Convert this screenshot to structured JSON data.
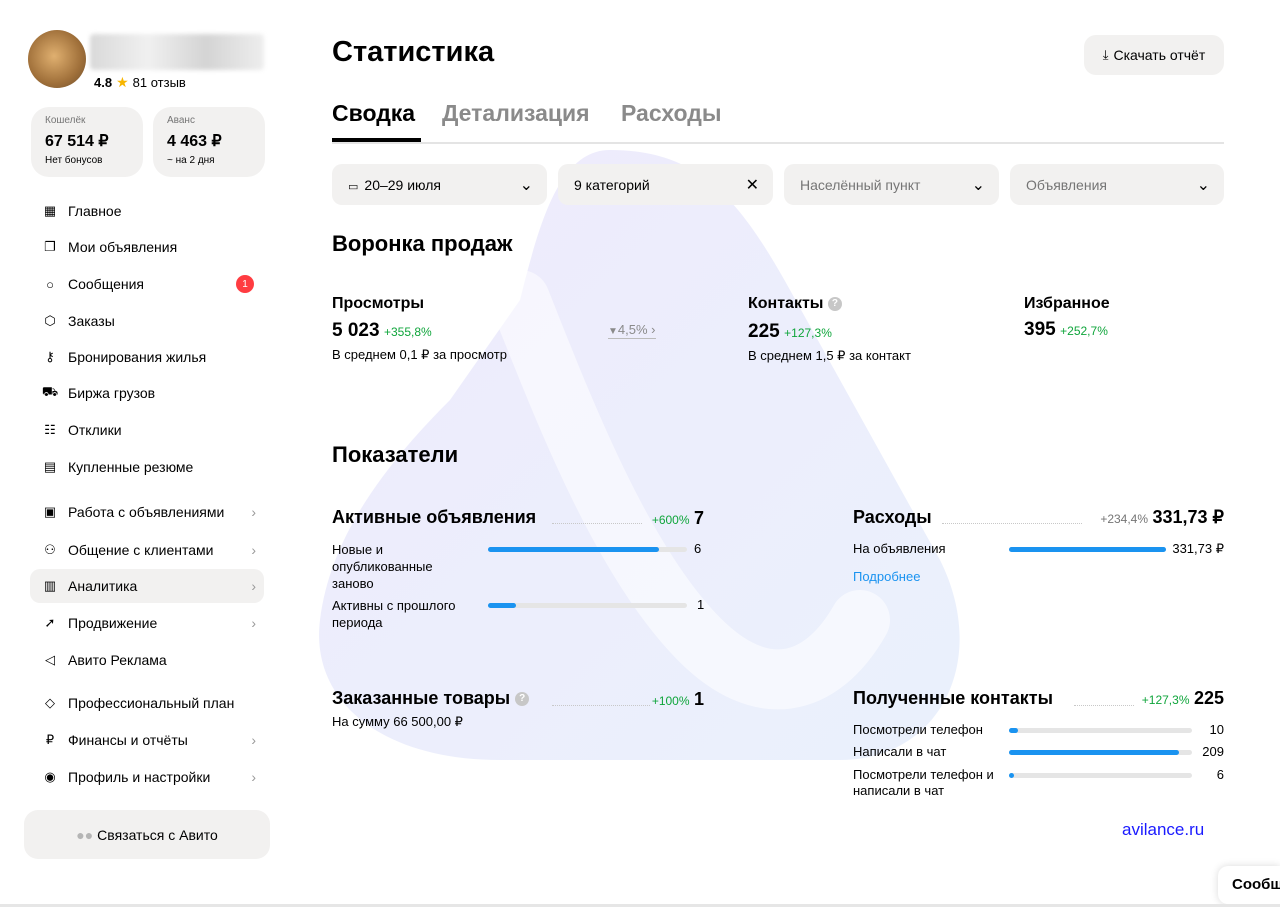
{
  "profile": {
    "rating": "4.8",
    "reviews": "81 отзыв"
  },
  "wallet": {
    "label": "Кошелёк",
    "value": "67 514 ₽",
    "sub": "Нет бонусов"
  },
  "advance": {
    "label": "Аванс",
    "value": "4 463 ₽",
    "sub": "~ на 2 дня"
  },
  "nav": [
    {
      "label": "Главное",
      "icon": "grid-icon"
    },
    {
      "label": "Мои объявления",
      "icon": "copy-icon"
    },
    {
      "label": "Сообщения",
      "icon": "chat-bubble-icon",
      "badge": "1"
    },
    {
      "label": "Заказы",
      "icon": "box-icon"
    },
    {
      "label": "Бронирования жилья",
      "icon": "key-icon"
    },
    {
      "label": "Биржа грузов",
      "icon": "truck-icon"
    },
    {
      "label": "Отклики",
      "icon": "response-icon"
    },
    {
      "label": "Купленные резюме",
      "icon": "document-icon"
    },
    {
      "label": "Работа с объявлениями",
      "icon": "listings-icon"
    },
    {
      "label": "Общение с клиентами",
      "icon": "people-icon"
    },
    {
      "label": "Аналитика",
      "icon": "bar-chart-icon"
    },
    {
      "label": "Продвижение",
      "icon": "rocket-icon"
    },
    {
      "label": "Авито Реклама",
      "icon": "megaphone-icon"
    },
    {
      "label": "Профессиональный план",
      "icon": "diamond-icon"
    },
    {
      "label": "Финансы и отчёты",
      "icon": "ruble-icon"
    },
    {
      "label": "Профиль и настройки",
      "icon": "user-circle-icon"
    }
  ],
  "contact_avito": "Связаться с Авито",
  "page_title": "Статистика",
  "download_report": "Скачать отчёт",
  "tabs": [
    "Сводка",
    "Детализация",
    "Расходы"
  ],
  "filters": {
    "date": "20–29 июля",
    "categories": "9 категорий",
    "locality": "Населённый пункт",
    "listings": "Объявления"
  },
  "funnel": {
    "title": "Воронка продаж",
    "views": {
      "title": "Просмотры",
      "value": "5 023",
      "change": "+355,8%",
      "note": "В среднем 0,1 ₽ за просмотр"
    },
    "conversion": "4,5%",
    "contacts": {
      "title": "Контакты",
      "value": "225",
      "change": "+127,3%",
      "note": "В среднем 1,5 ₽ за контакт"
    },
    "favorites": {
      "title": "Избранное",
      "value": "395",
      "change": "+252,7%"
    }
  },
  "indicators": {
    "title": "Показатели",
    "active": {
      "title": "Активные объявления",
      "change": "+600%",
      "value": "7",
      "rows": [
        {
          "label": "Новые и опубликованные заново",
          "value": "6",
          "fraction": 0.86
        },
        {
          "label": "Активны с прошлого периода",
          "value": "1",
          "fraction": 0.14
        }
      ]
    },
    "expenses": {
      "title": "Расходы",
      "change": "+234,4%",
      "value": "331,73 ₽",
      "rows": [
        {
          "label": "На объявления",
          "value": "331,73 ₽",
          "fraction": 1.0
        }
      ],
      "more": "Подробнее"
    },
    "ordered": {
      "title": "Заказанные товары",
      "change": "+100%",
      "value": "1",
      "note": "На сумму 66 500,00 ₽"
    },
    "received": {
      "title": "Полученные контакты",
      "change": "+127,3%",
      "value": "225",
      "rows": [
        {
          "label": "Посмотрели телефон",
          "value": "10",
          "fraction": 0.05
        },
        {
          "label": "Написали в чат",
          "value": "209",
          "fraction": 0.93
        },
        {
          "label": "Посмотрели телефон и написали в чат",
          "value": "6",
          "fraction": 0.03
        }
      ]
    }
  },
  "watermark_site": "avilance.ru",
  "corner_text": "Сообщ"
}
